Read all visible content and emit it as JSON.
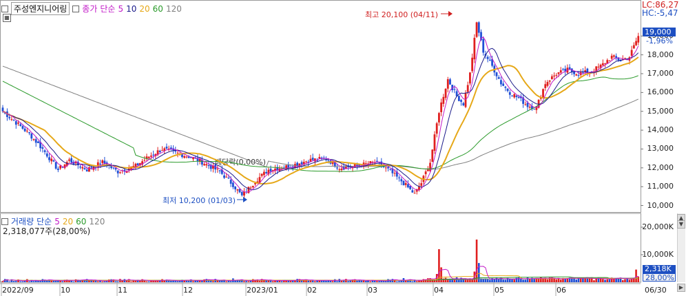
{
  "legend_price": {
    "title": "주성엔지니어링",
    "label": "종가",
    "method": "단순",
    "ma": [
      "5",
      "10",
      "20",
      "60",
      "120"
    ]
  },
  "legend_volume": {
    "label": "거래량",
    "method": "단순",
    "ma": [
      "5",
      "20",
      "60",
      "120"
    ],
    "value": "2,318,077주(28,00%)"
  },
  "top_right": {
    "lc": "LC:86,27",
    "hc": "HC:-5,47"
  },
  "price_tag": {
    "value": "19,000",
    "change": "-1,96%"
  },
  "volume_tags": {
    "value": "2,318K",
    "pct": "28,00%"
  },
  "annotations": {
    "high": "최고 20,100 (04/11)",
    "low": "최저 10,200 (01/03)",
    "event": "배당락(0,00%)"
  },
  "colors": {
    "up": "#e01f1f",
    "down": "#1f4fd6",
    "ma5": "#c21ac8",
    "ma10": "#1a1a8a",
    "ma20": "#e6a818",
    "ma60": "#2a9a2a",
    "ma120": "#808080"
  },
  "chart_data": {
    "type": "candlestick",
    "x_ticks": [
      "2022/09",
      "10",
      "11",
      "12",
      "2023/01",
      "02",
      "03",
      "04",
      "05",
      "06",
      "06/30"
    ],
    "price_axis": [
      "19,000",
      "18,000",
      "17,000",
      "16,000",
      "15,000",
      "14,000",
      "13,000",
      "12,000",
      "11,000",
      "10,000"
    ],
    "volume_axis": [
      "20,000K",
      "10,000K"
    ],
    "ylim": [
      9800,
      20400
    ],
    "high": 20100,
    "low": 10200,
    "anchors": [
      [
        0,
        15000
      ],
      [
        5,
        14500
      ],
      [
        12,
        13800
      ],
      [
        18,
        13000
      ],
      [
        25,
        11900
      ],
      [
        30,
        12400
      ],
      [
        38,
        11900
      ],
      [
        45,
        12300
      ],
      [
        52,
        11800
      ],
      [
        60,
        12100
      ],
      [
        66,
        12600
      ],
      [
        72,
        13000
      ],
      [
        78,
        12800
      ],
      [
        84,
        12600
      ],
      [
        90,
        12300
      ],
      [
        98,
        11800
      ],
      [
        104,
        11100
      ],
      [
        108,
        10500
      ],
      [
        114,
        11300
      ],
      [
        120,
        11900
      ],
      [
        130,
        12100
      ],
      [
        138,
        12400
      ],
      [
        146,
        12500
      ],
      [
        152,
        12000
      ],
      [
        160,
        12100
      ],
      [
        168,
        12300
      ],
      [
        174,
        11900
      ],
      [
        180,
        11300
      ],
      [
        186,
        10600
      ],
      [
        189,
        11200
      ],
      [
        193,
        12300
      ],
      [
        197,
        15000
      ],
      [
        201,
        16700
      ],
      [
        205,
        15800
      ],
      [
        208,
        15400
      ],
      [
        211,
        17000
      ],
      [
        214,
        19700
      ],
      [
        217,
        18200
      ],
      [
        221,
        17400
      ],
      [
        225,
        16500
      ],
      [
        229,
        16000
      ],
      [
        233,
        15700
      ],
      [
        237,
        15300
      ],
      [
        241,
        15200
      ],
      [
        245,
        16500
      ],
      [
        250,
        17000
      ],
      [
        255,
        17200
      ],
      [
        260,
        17000
      ],
      [
        265,
        17100
      ],
      [
        270,
        17400
      ],
      [
        275,
        17900
      ],
      [
        279,
        17700
      ],
      [
        283,
        17900
      ],
      [
        287,
        19000
      ]
    ],
    "volume_spikes": [
      [
        197,
        12000
      ],
      [
        214,
        15500
      ],
      [
        286,
        4600
      ],
      [
        279,
        1700
      ],
      [
        266,
        1600
      ],
      [
        181,
        1500
      ],
      [
        152,
        1200
      ],
      [
        104,
        1400
      ]
    ]
  }
}
